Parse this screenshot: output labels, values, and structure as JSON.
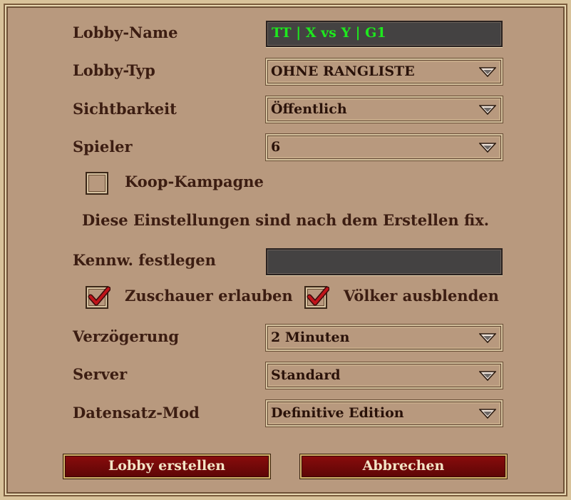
{
  "form": {
    "lobby_name": {
      "label": "Lobby-Name",
      "value": "TT | X vs Y | G1"
    },
    "lobby_type": {
      "label": "Lobby-Typ",
      "value": "OHNE RANGLISTE"
    },
    "visibility": {
      "label": "Sichtbarkeit",
      "value": "Öffentlich"
    },
    "players": {
      "label": "Spieler",
      "value": "6"
    },
    "coop_campaign": {
      "label": "Koop-Kampagne",
      "checked": false
    },
    "fixed_note": "Diese Einstellungen sind nach dem Erstellen fix.",
    "password": {
      "label": "Kennw. festlegen",
      "value": ""
    },
    "allow_spectators": {
      "label": "Zuschauer erlauben",
      "checked": true
    },
    "hide_civs": {
      "label": "Völker ausblenden",
      "checked": true
    },
    "delay": {
      "label": "Verzögerung",
      "value": "2 Minuten"
    },
    "server": {
      "label": "Server",
      "value": "Standard"
    },
    "data_mod": {
      "label": "Datensatz-Mod",
      "value": "Definitive Edition"
    }
  },
  "buttons": {
    "create": "Lobby erstellen",
    "cancel": "Abbrechen"
  },
  "colors": {
    "panel": "#b8997e",
    "label_text": "#3c1d12",
    "input_bg": "#444242",
    "input_text": "#1ee81e",
    "button_red": "#7a0a0a",
    "checkmark": "#c0141a"
  },
  "icons": {
    "dropdown": "chevron-down-icon",
    "check": "checkmark-icon"
  }
}
